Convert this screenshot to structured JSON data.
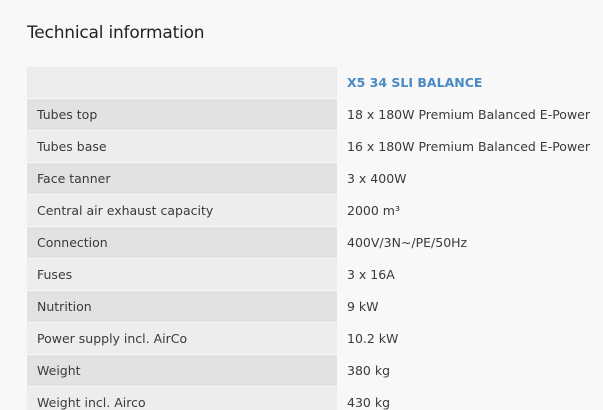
{
  "section": {
    "title": "Technical information"
  },
  "table": {
    "header_label": "",
    "model": "X5 34 SLI BALANCE",
    "rows": [
      {
        "label": "Tubes top",
        "value": "18 x 180W Premium Balanced E-Power"
      },
      {
        "label": "Tubes base",
        "value": "16 x 180W Premium Balanced E-Power"
      },
      {
        "label": "Face tanner",
        "value": "3 x 400W"
      },
      {
        "label": "Central air exhaust capacity",
        "value": "2000 m³"
      },
      {
        "label": "Connection",
        "value": "400V/3N~/PE/50Hz"
      },
      {
        "label": "Fuses",
        "value": "3 x 16A"
      },
      {
        "label": "Nutrition",
        "value": "9 kW"
      },
      {
        "label": "Power supply incl. AirCo",
        "value": "10.2 kW"
      },
      {
        "label": "Weight",
        "value": "380 kg"
      },
      {
        "label": "Weight incl. Airco",
        "value": "430 kg"
      }
    ]
  },
  "colors": {
    "accent": "#4a8ac4",
    "row_dark": "#e2e2e2",
    "row_light": "#ededed",
    "background": "#f8f8f8"
  }
}
